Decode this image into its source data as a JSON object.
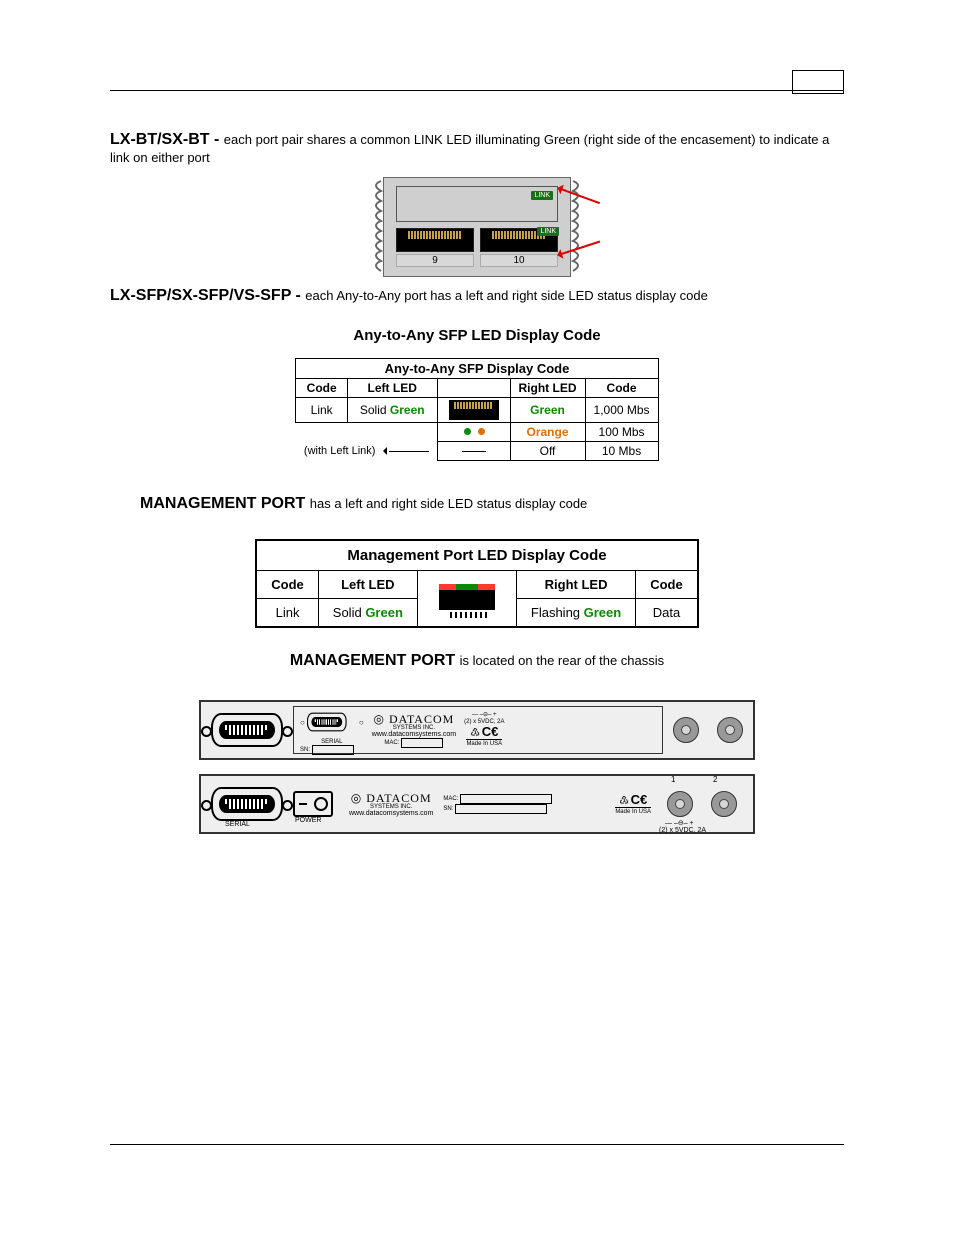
{
  "page": {
    "header_hr": true,
    "section1": {
      "heading": "LX-BT/SX-BT -",
      "body": "each port pair shares a common LINK LED illuminating Green (right side of the encasement) to indicate a link on either port"
    },
    "module_fig": {
      "port_left_num": "9",
      "port_right_num": "10",
      "link_label": "LINK"
    },
    "section2": {
      "heading": "LX-SFP/SX-SFP/VS-SFP -",
      "body": "each Any-to-Any port has a left and right side LED status display code",
      "fig_title": "Any-to-Any SFP LED Display Code"
    },
    "sfp_table": {
      "title": "Any-to-Any SFP Display Code",
      "head": {
        "code_l": "Code",
        "left_led": "Left LED",
        "right_led": "Right LED",
        "code_r": "Code"
      },
      "rows": [
        {
          "code_l": "Link",
          "left": "Solid Green",
          "right": "Green",
          "code_r": "1,000 Mbs"
        },
        {
          "code_l": "",
          "left": "",
          "right": "Orange",
          "code_r": "100 Mbs"
        },
        {
          "code_l_note": "(with Left Link)",
          "left": "",
          "right": "Off",
          "code_r": "10 Mbs"
        }
      ]
    },
    "mgmt_section": {
      "heading": "MANAGEMENT PORT",
      "body": "has a left and right side LED status display code"
    },
    "mgmt_table": {
      "title": "Management Port LED Display Code",
      "head": {
        "code_l": "Code",
        "left_led": "Left LED",
        "right_led": "Right LED",
        "code_r": "Code"
      },
      "row": {
        "code_l": "Link",
        "left_pre": "Solid ",
        "left_green": "Green",
        "right_pre": "Flashing ",
        "right_green": "Green",
        "code_r": "Data"
      }
    },
    "rear_heading": "MANAGEMENT PORT",
    "rear_heading_note": "is located on the rear of the chassis",
    "rear_panel_text": {
      "serial_label": "SERIAL",
      "power_label": "POWER",
      "brand": "DATACOM",
      "brand_sub": "SYSTEMS INC.",
      "url": "www.datacomsystems.com",
      "sn": "SN:",
      "mac": "MAC:",
      "pwr_spec_top": "— –⊖– +",
      "pwr_spec": "(2) x 5VDC, 2A",
      "made": "Made In USA",
      "ce": "CE",
      "num1": "1",
      "num2": "2"
    }
  }
}
